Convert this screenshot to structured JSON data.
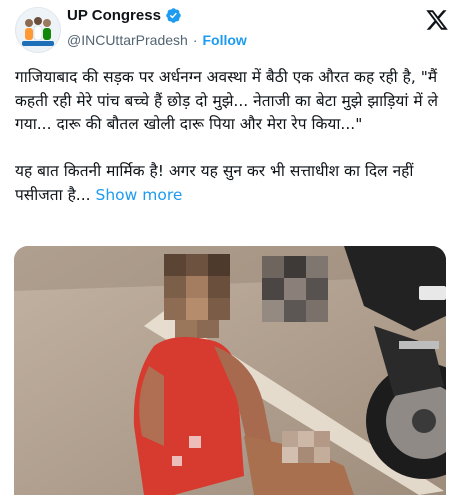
{
  "account": {
    "name": "UP Congress",
    "handle": "@INCUttarPradesh",
    "separator": "·",
    "follow_label": "Follow"
  },
  "tweet": {
    "text": "गाजियाबाद की सड़क पर अर्धनग्न अवस्था में बैठी एक औरत कह रही है, \"मैं कहती रही मेरे पांच बच्चे हैं छोड़ दो मुझे... नेताजी का बेटा मुझे झाड़ियां में ले गया... दारू की बौतल खोली दारू पिया और मेरा रेप किया...\"\n\nयह बात कितनी मार्मिक है! अगर यह सुन कर भी सत्ताधीश का दिल नहीं पसीजता है...",
    "show_more_label": " Show more"
  },
  "colors": {
    "link": "#1d9bf0",
    "verified": "#1d9bf0",
    "text": "#0f1419",
    "secondary": "#536471"
  },
  "icons": {
    "verified": "verified-badge-icon",
    "x_logo": "x-logo-icon"
  }
}
